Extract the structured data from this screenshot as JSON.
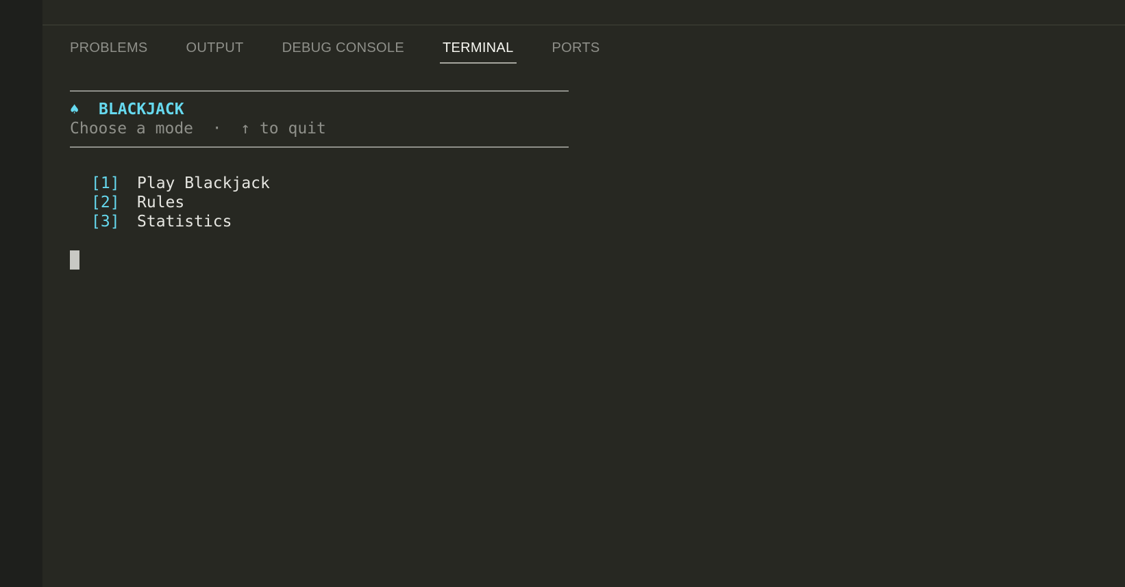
{
  "panel": {
    "tabs": [
      {
        "label": "PROBLEMS",
        "active": false
      },
      {
        "label": "OUTPUT",
        "active": false
      },
      {
        "label": "DEBUG CONSOLE",
        "active": false
      },
      {
        "label": "TERMINAL",
        "active": true
      },
      {
        "label": "PORTS",
        "active": false
      }
    ]
  },
  "terminal": {
    "spade_glyph": "♠",
    "title": "BLACKJACK",
    "subtitle": "Choose a mode  ·  ↑ to quit",
    "menu": [
      {
        "key": "[1]",
        "label": "Play Blackjack"
      },
      {
        "key": "[2]",
        "label": "Rules"
      },
      {
        "key": "[3]",
        "label": "Statistics"
      }
    ]
  },
  "colors": {
    "background": "#272822",
    "activity_bar": "#1e1f1c",
    "accent": "#66d9ef",
    "muted_text": "#8f908a",
    "text": "#e6e6e1"
  }
}
